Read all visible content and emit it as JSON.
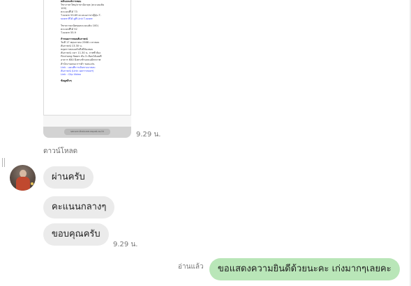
{
  "image_message": {
    "doc_lines": [
      {
        "t": "หลักเกณฑ์การสอบ",
        "s": "bold"
      },
      {
        "t": "วิชาภาษาไทย/ภาษาอังกฤษ (คะแนนเต็ม",
        "s": ""
      },
      {
        "t": "100)",
        "s": ""
      },
      {
        "t": "คะแนนที่ได้ 73",
        "s": ""
      },
      {
        "t": "T-score 53.69 คะแนนภาษาญี่ปุ่น T-",
        "s": ""
      },
      {
        "t": "score ที่ได้ ดูที่ Link T-score",
        "s": "link"
      },
      {
        "t": "",
        "s": "sp"
      },
      {
        "t": "วิชาความถนัดทุนคะแนนเต็ม 100)",
        "s": ""
      },
      {
        "t": "คะแนนที่ได้ 52",
        "s": ""
      },
      {
        "t": "T-score 55.9",
        "s": ""
      },
      {
        "t": "",
        "s": "sp"
      },
      {
        "t": "กำหนดการสอบสัมภาษณ์",
        "s": "bold"
      },
      {
        "t": "วันที่ 17 พฤษภาคม 2568 เวลาสอบ",
        "s": ""
      },
      {
        "t": "สัมภาษณ์ 13.30 น.",
        "s": ""
      },
      {
        "t": "หลุดการสอบเสร็จถึงมีห้องสอบ",
        "s": ""
      },
      {
        "t": "สัมภาษณ์ เวลา 11.30 น. ภาพที่ ห้อง",
        "s": ""
      },
      {
        "t": "Pinchong Room ชั้น 3 เลื่อนได้เลยที่",
        "s": ""
      },
      {
        "t": "อาคาร KKU ฝั่งตรงข้ามถนนมิตรภาพ",
        "s": ""
      },
      {
        "t": "สำนักงานคณะการค้า ขอนแก่น",
        "s": ""
      },
      {
        "t": "Link : แผนที่การเดินทางมาสอบ",
        "s": "link"
      },
      {
        "t": "สัมภาษณ์ (Link: ผลการสอบฯ)",
        "s": "link"
      },
      {
        "t": "Link : Clip Video",
        "s": "link"
      },
      {
        "t": "",
        "s": "sp"
      },
      {
        "t": "ข้อมูลอื่นๆ",
        "s": "bold"
      }
    ],
    "url_text": "secure.thaicare.expat.co.th",
    "time": "9.29 น."
  },
  "download_label": "ดาวน์โหลด",
  "incoming": {
    "messages": [
      "ผ่านครับ",
      "คะแนนกลางๆ",
      "ขอบคุณครับ"
    ],
    "time": "9.29 น."
  },
  "outgoing": {
    "read_label": "อ่านแล้ว",
    "message": "ขอแสดงความยินดีด้วยนะคะ เก่งมากๆเลยคะ"
  },
  "colors": {
    "incoming_bubble": "#ebebeb",
    "outgoing_bubble": "#b9e6b8",
    "link": "#2a3cff"
  }
}
